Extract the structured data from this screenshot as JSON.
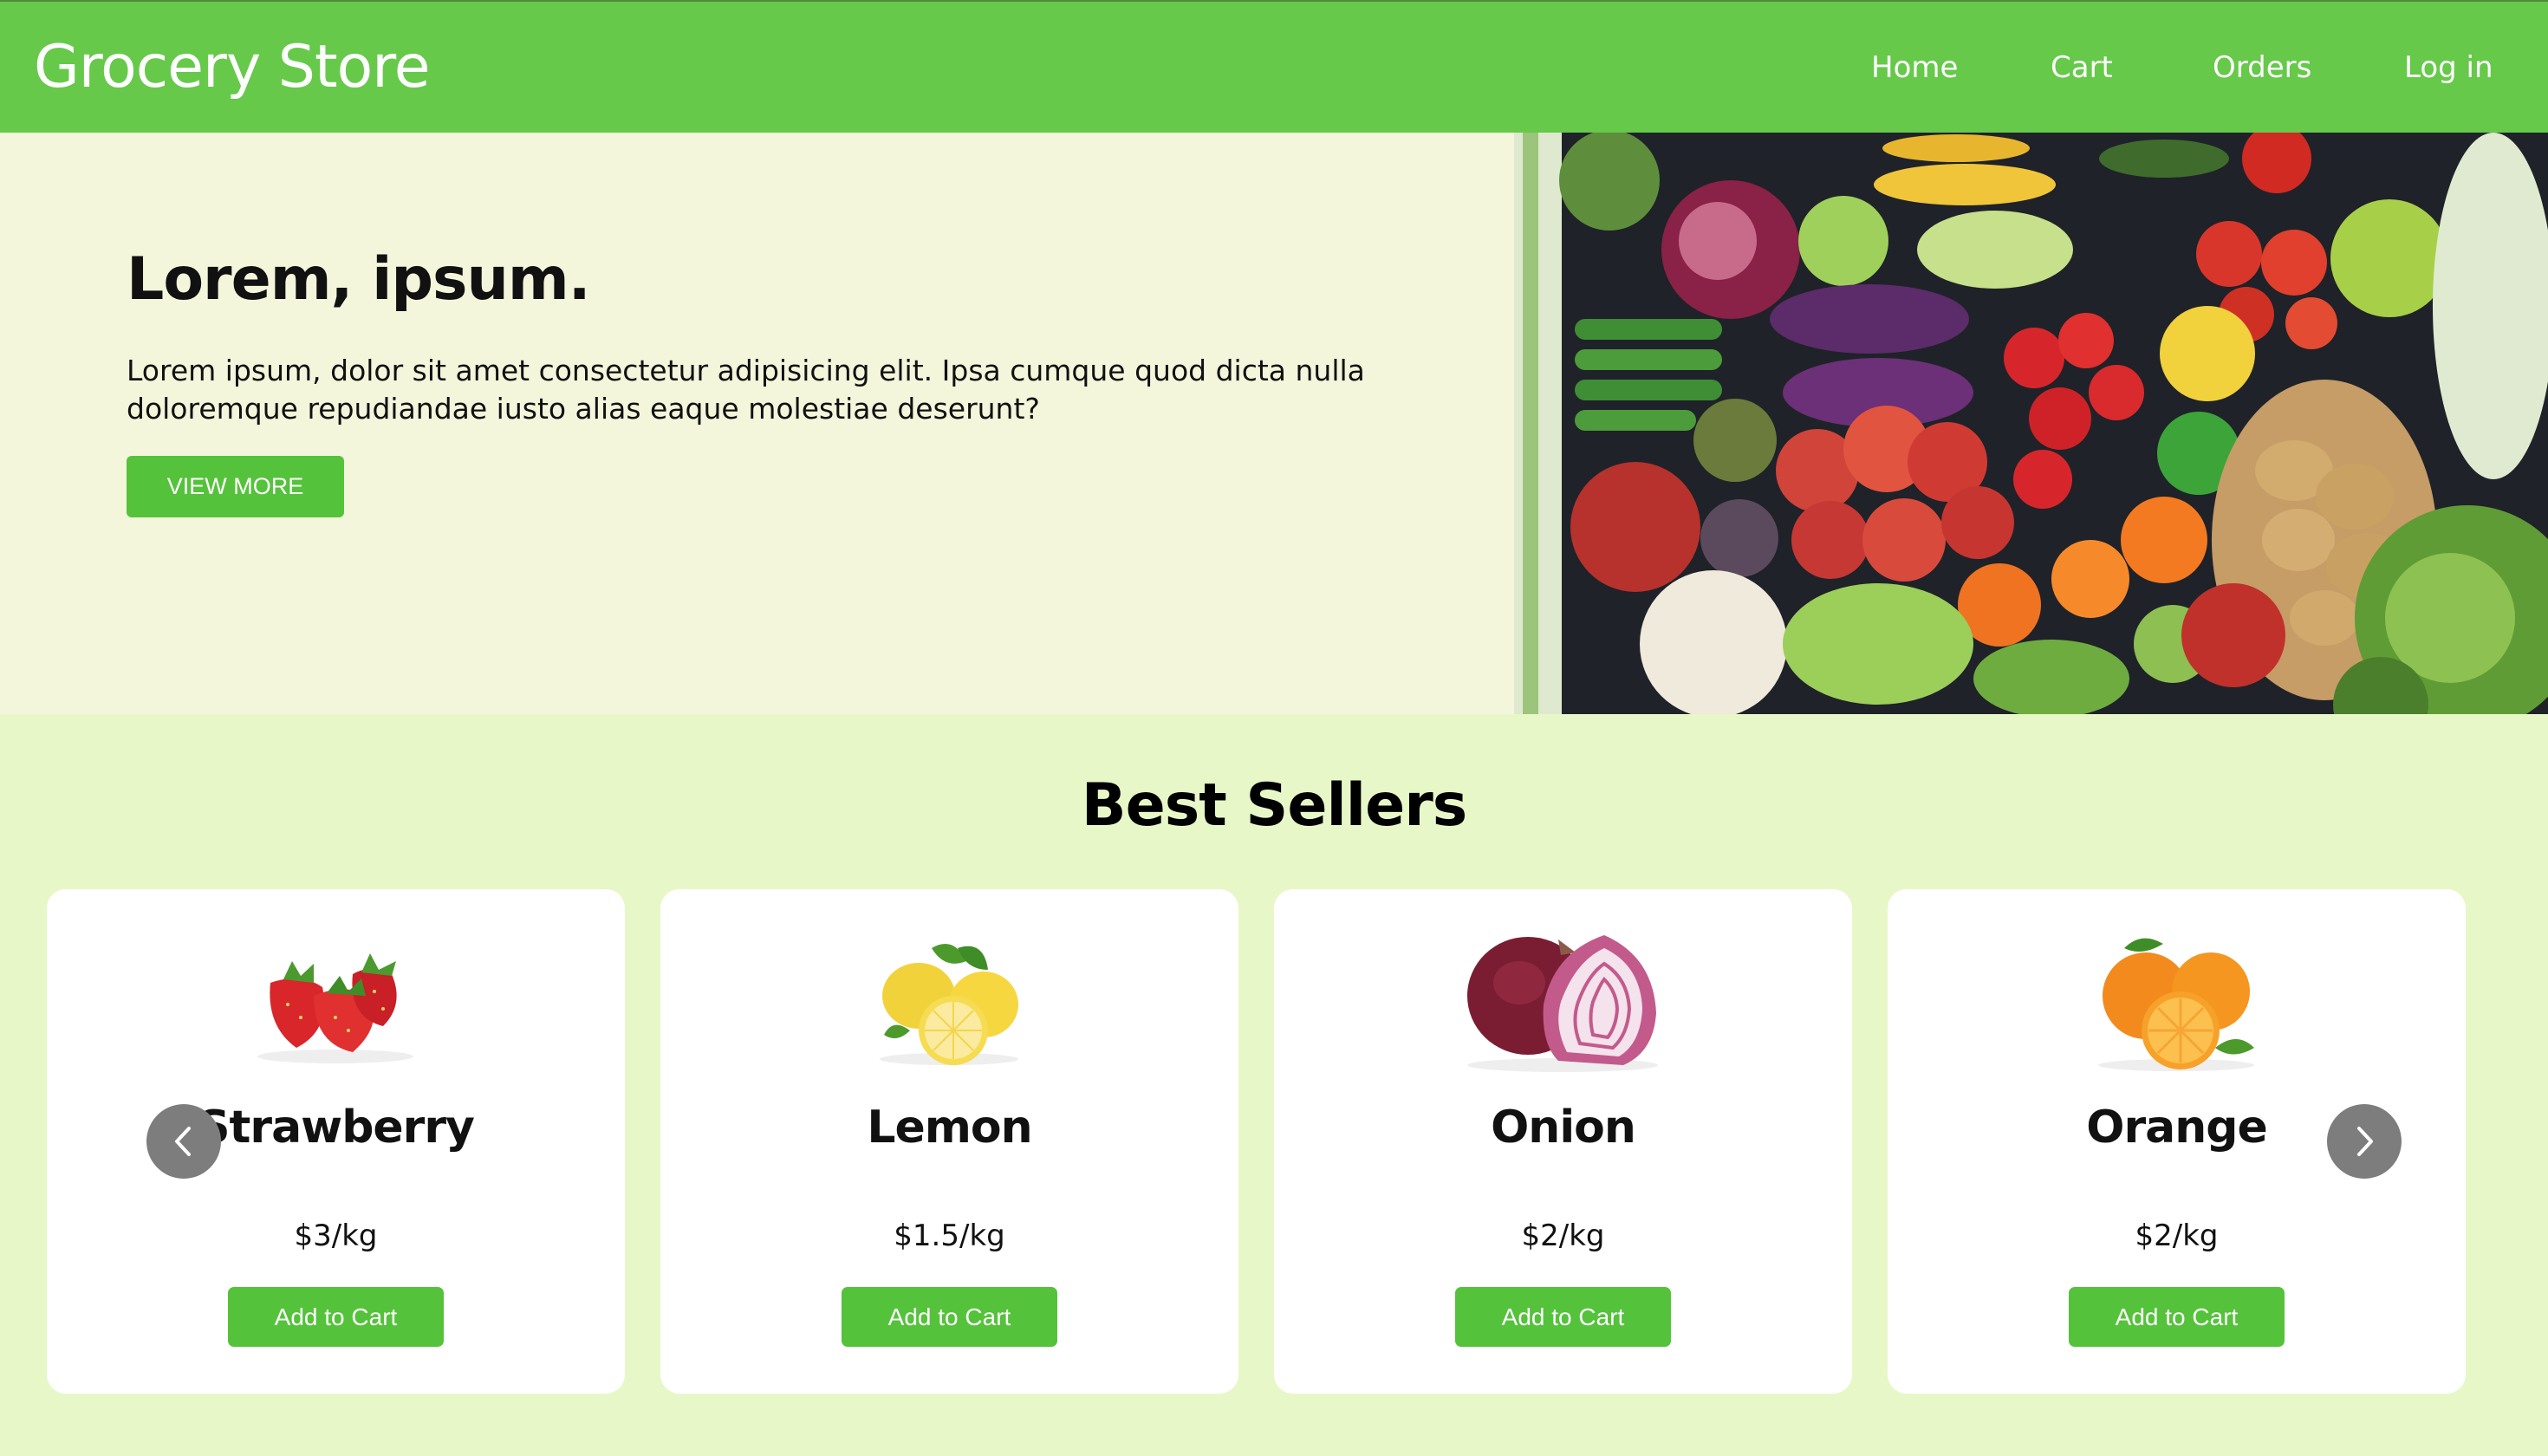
{
  "header": {
    "brand": "Grocery Store",
    "nav": [
      {
        "label": "Home"
      },
      {
        "label": "Cart"
      },
      {
        "label": "Orders"
      },
      {
        "label": "Log in"
      }
    ]
  },
  "hero": {
    "title": "Lorem, ipsum.",
    "text": "Lorem ipsum, dolor sit amet consectetur adipisicing elit. Ipsa cumque quod dicta nulla doloremque repudiandae iusto alias eaque molestiae deserunt?",
    "button_label": "VIEW MORE",
    "image": "vegetables-assortment-photo"
  },
  "best_sellers": {
    "title": "Best Sellers",
    "products": [
      {
        "name": "Strawberry",
        "price": "$3/kg",
        "button_label": "Add to Cart",
        "image": "strawberry-image"
      },
      {
        "name": "Lemon",
        "price": "$1.5/kg",
        "button_label": "Add to Cart",
        "image": "lemon-image"
      },
      {
        "name": "Onion",
        "price": "$2/kg",
        "button_label": "Add to Cart",
        "image": "onion-image"
      },
      {
        "name": "Orange",
        "price": "$2/kg",
        "button_label": "Add to Cart",
        "image": "orange-image"
      }
    ],
    "prev_icon": "chevron-left-icon",
    "next_icon": "chevron-right-icon"
  },
  "colors": {
    "header_bg": "#66c94a",
    "hero_bg": "#f4f6dc",
    "page_bg": "#e8f7c8",
    "button_bg": "#55c23b",
    "card_bg": "#ffffff",
    "arrow_bg": "#7d7d7d"
  }
}
